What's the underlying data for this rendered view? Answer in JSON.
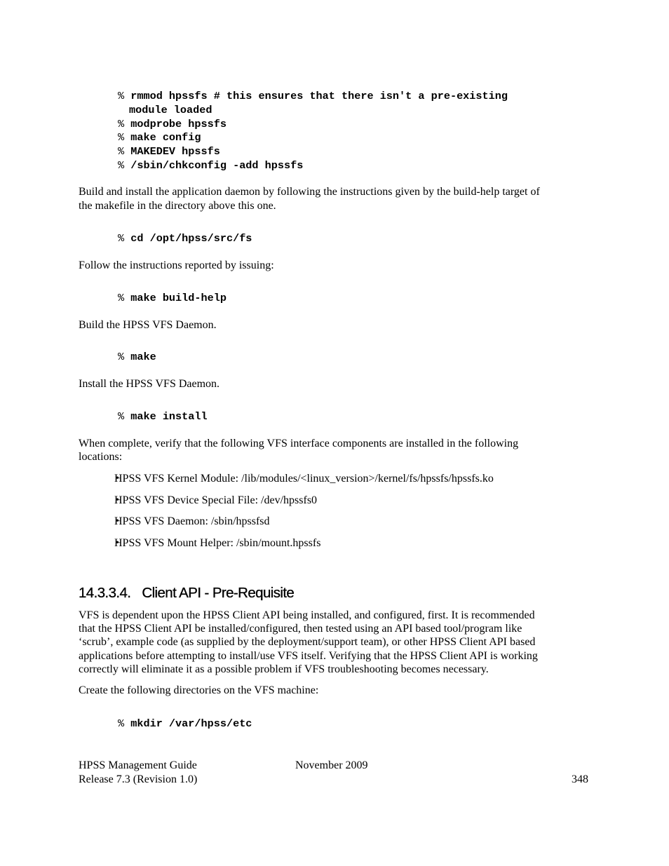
{
  "code_block_1": [
    {
      "prompt": "%",
      "cmd": "rmmod hpssfs  # this ensures that there isn't a pre-existing"
    },
    {
      "prompt": "",
      "cmd": "module loaded"
    },
    {
      "prompt": "%",
      "cmd": "modprobe hpssfs"
    },
    {
      "prompt": "%",
      "cmd": "make config"
    },
    {
      "prompt": "%",
      "cmd": "MAKEDEV hpssfs"
    },
    {
      "prompt": "%",
      "cmd": "/sbin/chkconfig -add hpssfs"
    }
  ],
  "para_build_install": [
    "Build and install the application daemon by following the instructions given by the build-help target of",
    "the makefile in the directory above this one."
  ],
  "code_cd": {
    "prompt": "%",
    "cmd": "cd /opt/hpss/src/fs"
  },
  "para_follow": "Follow the instructions reported by issuing:",
  "code_build_help": {
    "prompt": "%",
    "cmd": "make build-help"
  },
  "para_build_daemon": "Build the HPSS VFS Daemon.",
  "code_make": {
    "prompt": "%",
    "cmd": "make"
  },
  "para_install_daemon": "Install the HPSS VFS Daemon.",
  "code_make_install": {
    "prompt": "%",
    "cmd": "make install"
  },
  "para_verify": [
    "When complete, verify that the following VFS interface components are installed in the following",
    "locations:"
  ],
  "bullets": [
    "HPSS VFS Kernel Module: /lib/modules/<linux_version>/kernel/fs/hpssfs/hpssfs.ko",
    "HPSS VFS Device Special File: /dev/hpssfs0",
    "HPSS VFS Daemon: /sbin/hpssfsd",
    "HPSS VFS Mount Helper: /sbin/mount.hpssfs"
  ],
  "bullet_glyph": "•",
  "section_heading": {
    "number": "14.3.3.4.",
    "title": "Client API - Pre-Requisite"
  },
  "para_client_api": [
    "VFS is dependent upon the HPSS Client API being installed, and configured, first.  It is recommended",
    "that the HPSS Client API be installed/configured, then tested using an API based tool/program like",
    "‘scrub’, example code (as supplied by the deployment/support team), or other HPSS Client API based",
    "applications before attempting to install/use VFS itself.  Verifying that the HPSS Client API is working",
    "correctly will eliminate it as a possible problem if VFS troubleshooting becomes necessary."
  ],
  "para_create_dirs": "Create the following directories on the VFS machine:",
  "code_mkdir": {
    "prompt": "%",
    "cmd": "mkdir /var/hpss/etc"
  },
  "footer": {
    "title": "HPSS Management Guide",
    "release": "Release 7.3 (Revision 1.0)",
    "date": "November 2009",
    "page_number": "348"
  }
}
